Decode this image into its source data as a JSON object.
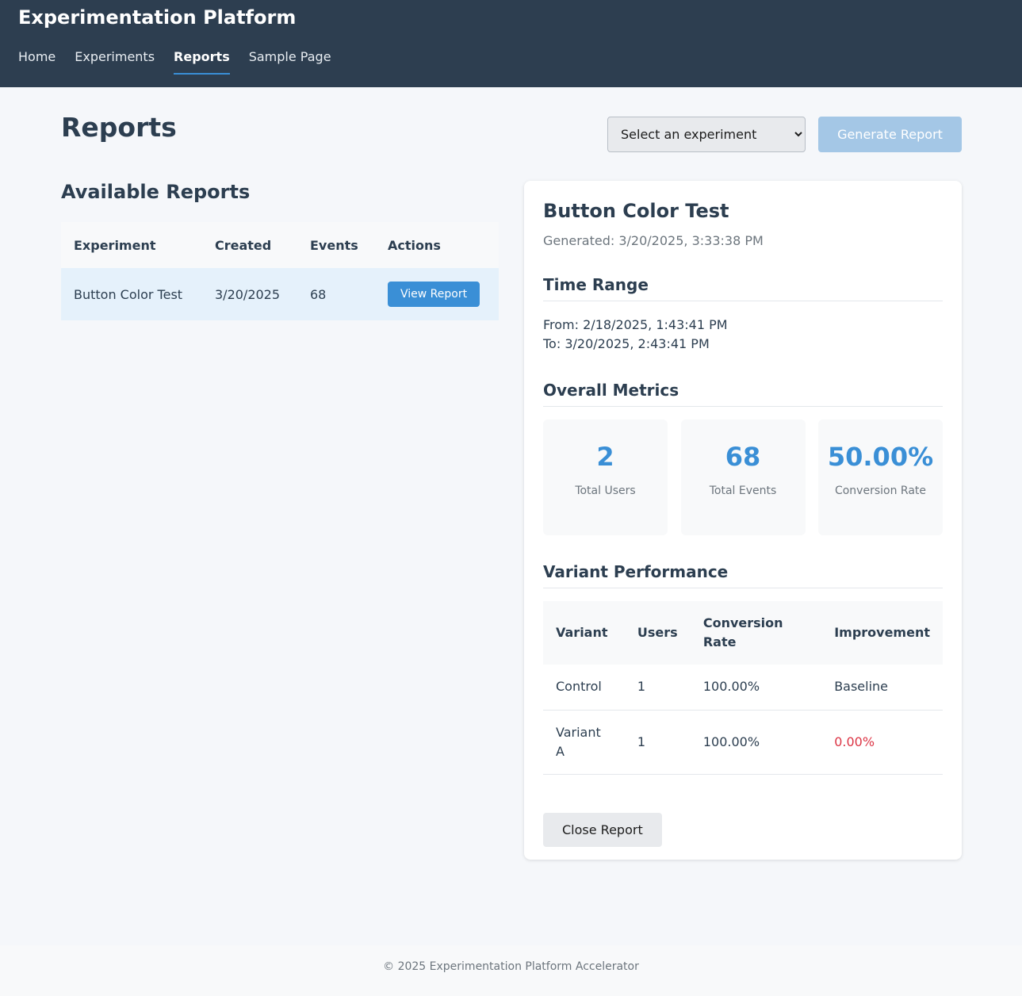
{
  "app": {
    "title": "Experimentation Platform"
  },
  "nav": [
    {
      "label": "Home"
    },
    {
      "label": "Experiments"
    },
    {
      "label": "Reports"
    },
    {
      "label": "Sample Page"
    }
  ],
  "page": {
    "title": "Reports",
    "select_value": "Select an experiment",
    "generate_label": "Generate Report"
  },
  "available": {
    "title": "Available Reports",
    "columns": [
      "Experiment",
      "Created",
      "Events",
      "Actions"
    ],
    "rows": [
      {
        "experiment": "Button Color Test",
        "created": "3/20/2025",
        "events": "68",
        "action": "View Report"
      }
    ]
  },
  "report": {
    "title": "Button Color Test",
    "generated": "Generated: 3/20/2025, 3:33:38 PM",
    "time_range": {
      "title": "Time Range",
      "from": "From: 2/18/2025, 1:43:41 PM",
      "to": "To: 3/20/2025, 2:43:41 PM"
    },
    "metrics": {
      "title": "Overall Metrics",
      "items": [
        {
          "value": "2",
          "label": "Total Users"
        },
        {
          "value": "68",
          "label": "Total Events"
        },
        {
          "value": "50.00%",
          "label": "Conversion Rate"
        }
      ]
    },
    "variants": {
      "title": "Variant Performance",
      "columns": [
        "Variant",
        "Users",
        "Conversion Rate",
        "Improvement"
      ],
      "rows": [
        {
          "variant": "Control",
          "users": "1",
          "rate": "100.00%",
          "improvement": "Baseline"
        },
        {
          "variant": "Variant A",
          "users": "1",
          "rate": "100.00%",
          "improvement": "0.00%"
        }
      ]
    },
    "close_label": "Close Report"
  },
  "footer": {
    "text": "© 2025 Experimentation Platform Accelerator"
  },
  "colors": {
    "accent": "#3a8fd6",
    "header_bg": "#2d3e50",
    "negative": "#dc3545"
  }
}
